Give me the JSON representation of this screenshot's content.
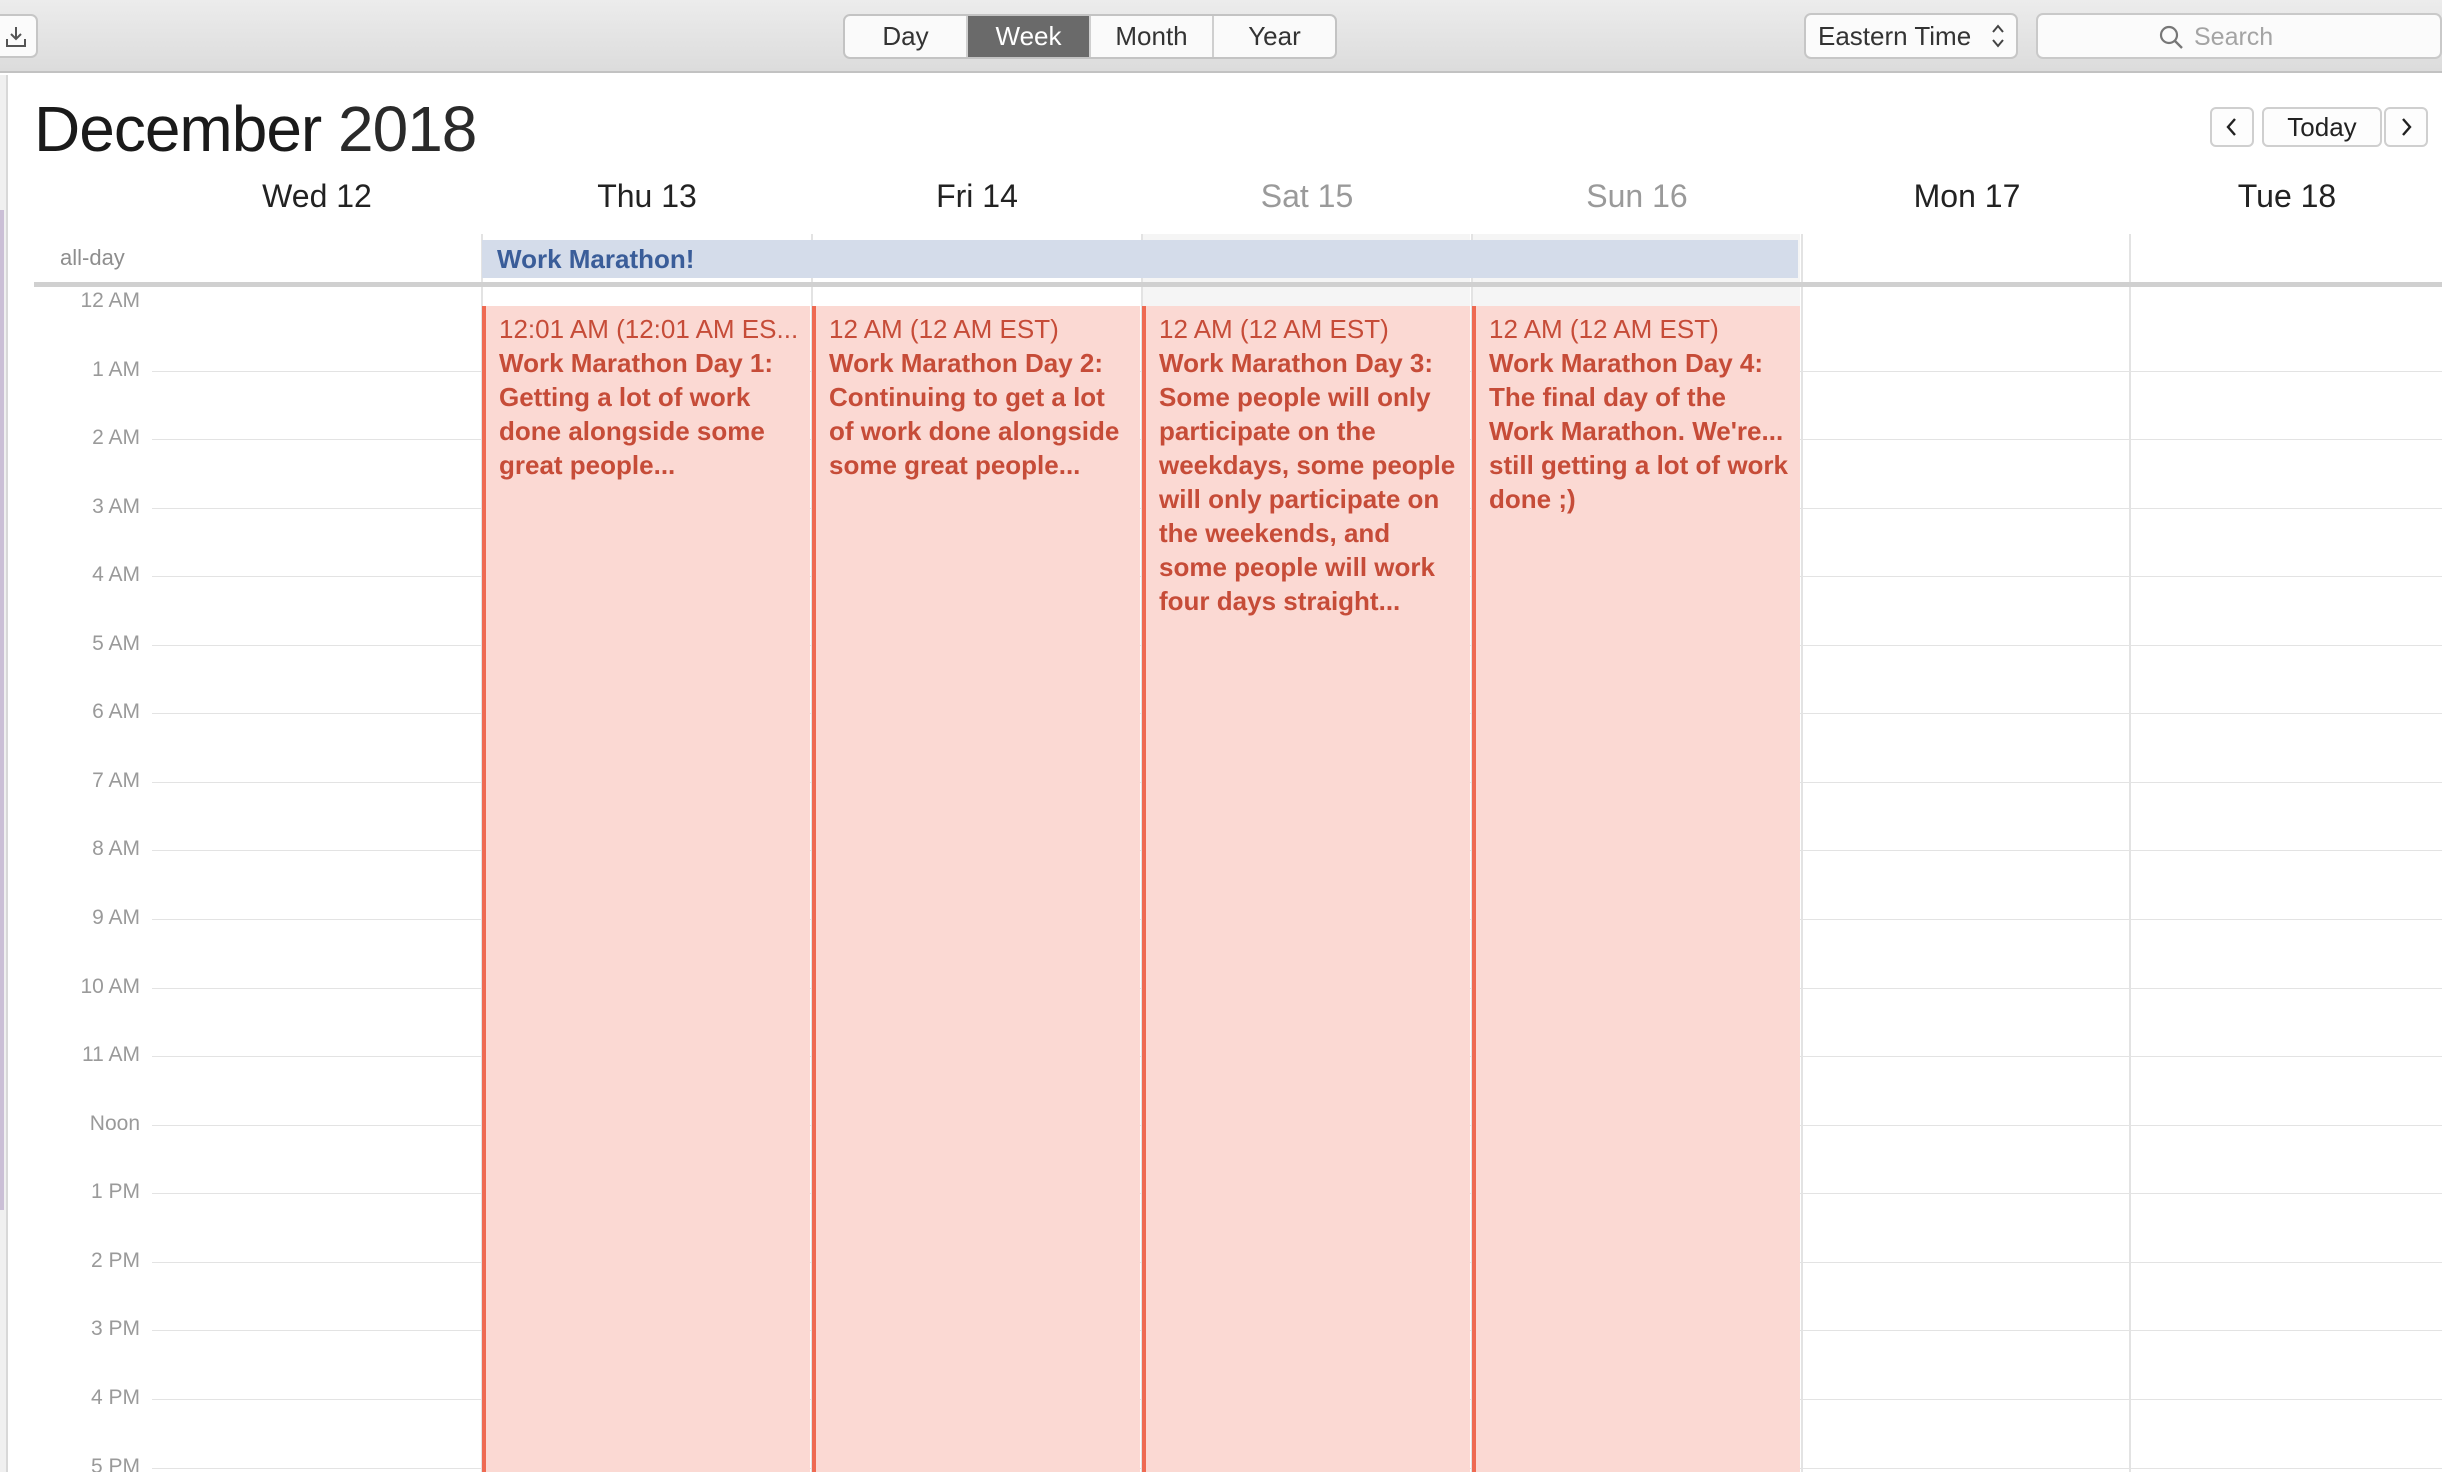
{
  "toolbar": {
    "download_icon": "tray-arrow-down-icon",
    "views": [
      "Day",
      "Week",
      "Month",
      "Year"
    ],
    "active_view": "Week",
    "timezone": "Eastern Time",
    "search_placeholder": "Search"
  },
  "header": {
    "month": "December",
    "year": "2018",
    "prev_icon": "chevron-left-icon",
    "today_label": "Today",
    "next_icon": "chevron-right-icon"
  },
  "days": [
    "Wed 12",
    "Thu 13",
    "Fri 14",
    "Sat 15",
    "Sun 16",
    "Mon 17",
    "Tue 18"
  ],
  "allday": {
    "label": "all-day",
    "event_title": "Work Marathon!"
  },
  "hours": [
    "12 AM",
    "1 AM",
    "2 AM",
    "3 AM",
    "4 AM",
    "5 AM",
    "6 AM",
    "7 AM",
    "8 AM",
    "9 AM",
    "10 AM",
    "11 AM",
    "Noon",
    "1 PM",
    "2 PM",
    "3 PM",
    "4 PM",
    "5 PM"
  ],
  "events": [
    {
      "time": "12:01 AM (12:01 AM ES...",
      "title": "Work Marathon Day 1: Getting a lot of work done alongside some great people..."
    },
    {
      "time": "12 AM (12 AM EST)",
      "title": "Work Marathon Day 2: Continuing to get a lot of work done alongside some great people..."
    },
    {
      "time": "12 AM (12 AM EST)",
      "title": "Work Marathon Day 3: Some people will only participate on the weekdays, some people will only participate on the weekends, and some people will work four days straight..."
    },
    {
      "time": "12 AM (12 AM EST)",
      "title": "Work Marathon Day 4: The final day of the Work Marathon. We're... still getting a lot of work done ;)"
    }
  ],
  "colors": {
    "event_fill": "#fbd9d3",
    "event_accent": "#ee6a52",
    "allday_fill": "#d4dcea",
    "allday_text": "#3a5d99"
  }
}
